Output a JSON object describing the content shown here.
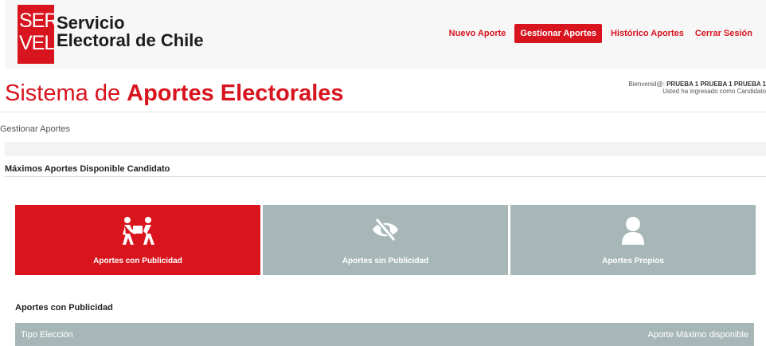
{
  "logo": {
    "line1": "SER",
    "line2": "VEL"
  },
  "brand": {
    "line1": "Servicio",
    "line2": "Electoral de Chile"
  },
  "nav": [
    {
      "label": "Nuevo Aporte",
      "active": false
    },
    {
      "label": "Gestionar Aportes",
      "active": true
    },
    {
      "label": "Histórico Aportes",
      "active": false
    },
    {
      "label": "Cerrar Sesión",
      "active": false
    }
  ],
  "page": {
    "title_light": "Sistema de ",
    "title_bold": "Aportes Electorales",
    "welcome_prefix": "Bienvenid@: ",
    "welcome_name": "PRUEBA 1 PRUEBA 1 PRUEBA 1",
    "welcome_role": "Usted ha ingresado como Candidato",
    "breadcrumb": "Gestionar Aportes",
    "section_title": "Máximos Aportes Disponible Candidato"
  },
  "cards": [
    {
      "label": "Aportes con Publicidad",
      "icon": "people-carry-icon",
      "active": true
    },
    {
      "label": "Aportes sin Publicidad",
      "icon": "eye-slash-icon",
      "active": false
    },
    {
      "label": "Aportes Propios",
      "icon": "user-icon",
      "active": false
    }
  ],
  "table": {
    "title": "Aportes con Publicidad",
    "headers": [
      "Tipo Elección",
      "Aporte Máximo disponible"
    ]
  },
  "colors": {
    "accent": "#d8141e",
    "card_inactive": "#a7b7b8"
  }
}
